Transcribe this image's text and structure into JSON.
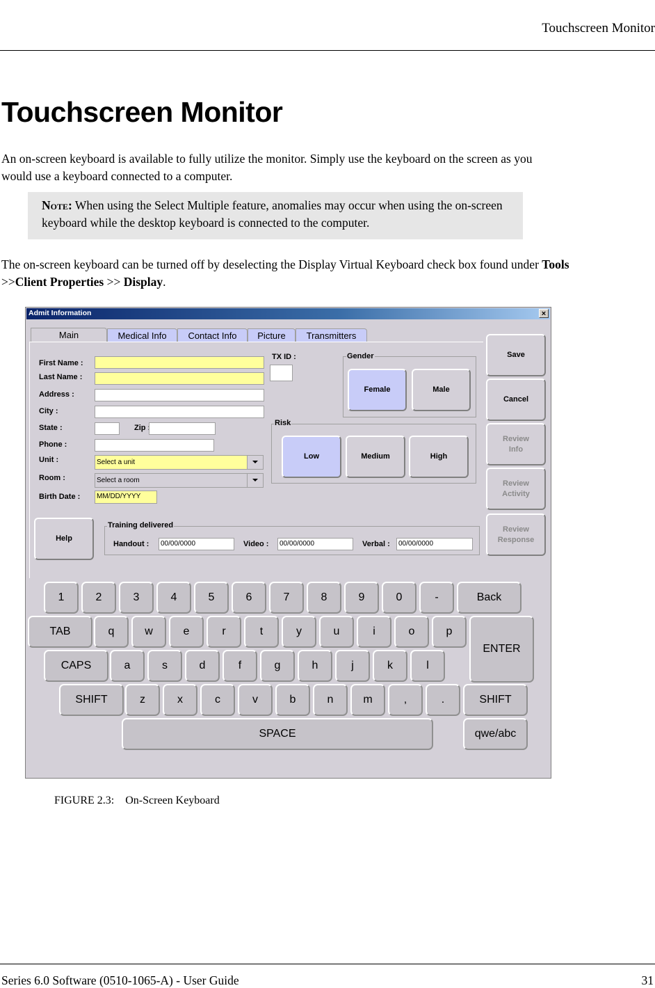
{
  "header": {
    "running_title": "Touchscreen Monitor"
  },
  "page_title": "Touchscreen Monitor",
  "intro_paragraph": "An on-screen keyboard is available to fully utilize the monitor. Simply use the keyboard on the screen as you would use a keyboard connected to a computer.",
  "note": {
    "label": "Note:",
    "text": " When using the Select Multiple feature, anomalies may occur when using the on-screen keyboard while the desktop keyboard is connected to the computer."
  },
  "second_paragraph": {
    "text": "The on-screen keyboard can be turned off by deselecting the Display Virtual Keyboard check box found under ",
    "path_1": "Tools",
    "sep_1": " >>",
    "path_2": "Client Properties",
    "sep_2": " >> ",
    "path_3": "Display",
    "end": "."
  },
  "screenshot": {
    "window_title": "Admit Information",
    "close_label": "×",
    "tabs": [
      {
        "label": "Main",
        "active": true
      },
      {
        "label": "Medical Info",
        "active": false
      },
      {
        "label": "Contact Info",
        "active": false
      },
      {
        "label": "Picture",
        "active": false
      },
      {
        "label": "Transmitters",
        "active": false
      }
    ],
    "form": {
      "first_name_label": "First Name :",
      "last_name_label": "Last Name :",
      "address_label": "Address :",
      "city_label": "City :",
      "state_label": "State :",
      "zip_label": "Zip :",
      "phone_label": "Phone :",
      "unit_label": "Unit :",
      "unit_value": "Select a unit",
      "room_label": "Room :",
      "room_value": "Select a room",
      "birth_date_label": "Birth Date :",
      "birth_date_value": "MM/DD/YYYY",
      "tx_id_label": "TX ID :"
    },
    "gender": {
      "label": "Gender",
      "options": [
        "Female",
        "Male"
      ],
      "selected": "Female"
    },
    "risk": {
      "label": "Risk",
      "options": [
        "Low",
        "Medium",
        "High"
      ],
      "selected": "Low"
    },
    "side_buttons": [
      {
        "label": "Save",
        "enabled": true
      },
      {
        "label": "Cancel",
        "enabled": true
      },
      {
        "label": "Review Info",
        "enabled": false
      },
      {
        "label": "Review Activity",
        "enabled": false
      },
      {
        "label": "Review Response",
        "enabled": false
      }
    ],
    "help_label": "Help",
    "training": {
      "label": "Training delivered",
      "handout_label": "Handout :",
      "handout_value": "00/00/0000",
      "video_label": "Video :",
      "video_value": "00/00/0000",
      "verbal_label": "Verbal :",
      "verbal_value": "00/00/0000"
    },
    "keyboard": {
      "row1": [
        "1",
        "2",
        "3",
        "4",
        "5",
        "6",
        "7",
        "8",
        "9",
        "0",
        "-",
        "Back"
      ],
      "row2": [
        "TAB",
        "q",
        "w",
        "e",
        "r",
        "t",
        "y",
        "u",
        "i",
        "o",
        "p"
      ],
      "enter": "ENTER",
      "row3": [
        "CAPS",
        "a",
        "s",
        "d",
        "f",
        "g",
        "h",
        "j",
        "k",
        "l"
      ],
      "row4": [
        "SHIFT",
        "z",
        "x",
        "c",
        "v",
        "b",
        "n",
        "m",
        ",",
        ".",
        "SHIFT"
      ],
      "space": "SPACE",
      "toggle": "qwe/abc"
    }
  },
  "figure_caption": "FIGURE 2.3:    On-Screen Keyboard",
  "footer": {
    "left": "Series 6.0 Software (0510-1065-A) - User Guide",
    "page_number": "31"
  }
}
